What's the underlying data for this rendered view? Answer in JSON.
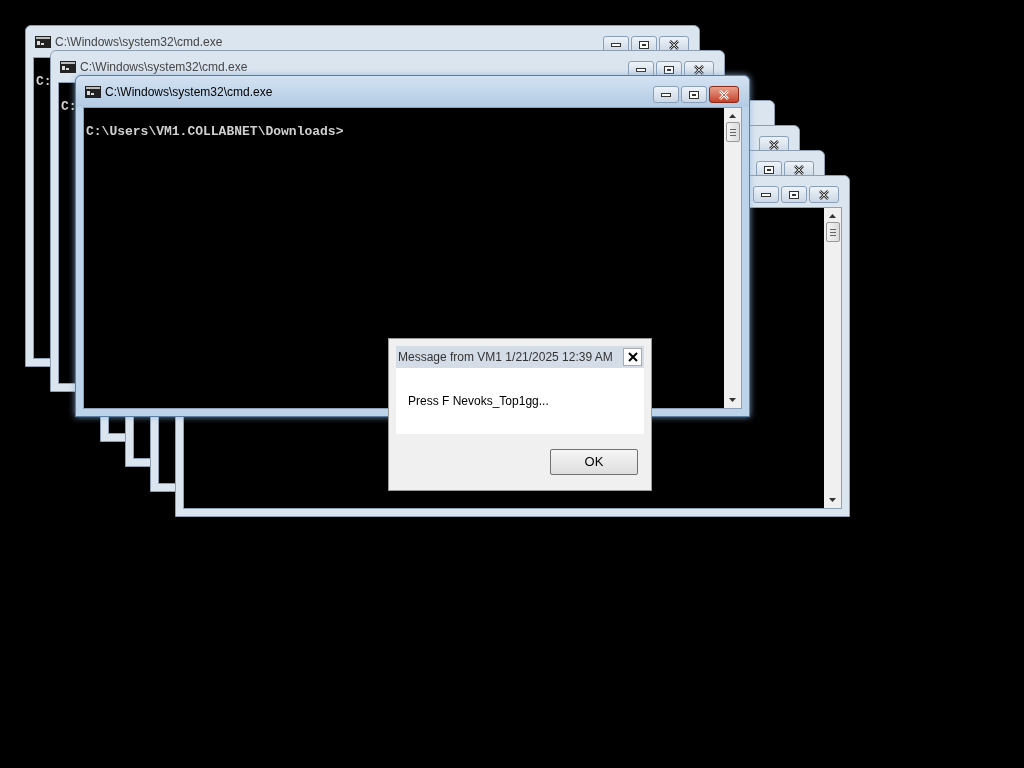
{
  "windows": [
    {
      "title": "C:\\Windows\\system32\\cmd.exe",
      "console_text": "C:",
      "active": false
    },
    {
      "title": "C:\\Windows\\system32\\cmd.exe",
      "console_text": "C:",
      "active": false
    },
    {
      "title": "C:\\Windows\\system32\\cmd.exe",
      "console_text": "C:\\Users\\VM1.COLLABNET\\Downloads>",
      "active": true
    },
    {
      "active": false
    },
    {
      "active": false
    },
    {
      "active": false
    },
    {
      "active": false
    }
  ],
  "dialog": {
    "title": "Message from VM1 1/21/2025 12:39 AM",
    "message": "Press F Nevoks_Top1gg...",
    "button": "OK"
  }
}
